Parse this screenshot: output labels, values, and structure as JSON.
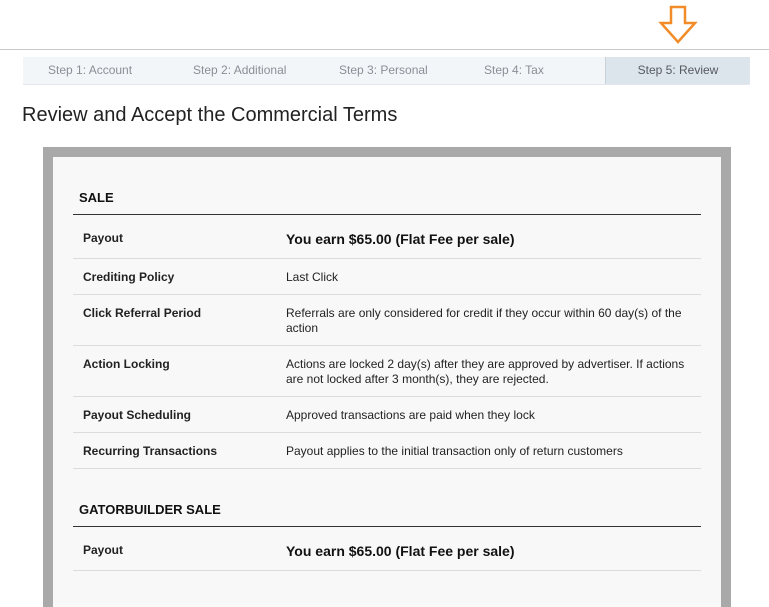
{
  "steps": [
    {
      "label": "Step 1: Account"
    },
    {
      "label": "Step 2: Additional"
    },
    {
      "label": "Step 3: Personal"
    },
    {
      "label": "Step 4: Tax"
    },
    {
      "label": "Step 5: Review",
      "active": true
    }
  ],
  "page_title": "Review and Accept the Commercial Terms",
  "arrow_icon": "down-arrow-icon",
  "colors": {
    "arrow": "#f28c28",
    "frame": "#a9a9a9",
    "active_step": "#dde5ec"
  },
  "sections": [
    {
      "title": "SALE",
      "rows": [
        {
          "label": "Payout",
          "value": "You earn $65.00 (Flat Fee per sale)"
        },
        {
          "label": "Crediting Policy",
          "value": "Last Click"
        },
        {
          "label": "Click Referral Period",
          "value": "Referrals are only considered for credit if they occur within 60 day(s) of the action"
        },
        {
          "label": "Action Locking",
          "value": "Actions are locked 2 day(s) after they are approved by advertiser. If actions are not locked after 3 month(s), they are rejected."
        },
        {
          "label": "Payout Scheduling",
          "value": "Approved transactions are paid when they lock"
        },
        {
          "label": "Recurring Transactions",
          "value": "Payout applies to the initial transaction only of return customers"
        }
      ]
    },
    {
      "title": "GATORBUILDER SALE",
      "rows": [
        {
          "label": "Payout",
          "value": "You earn $65.00 (Flat Fee per sale)"
        }
      ]
    }
  ]
}
